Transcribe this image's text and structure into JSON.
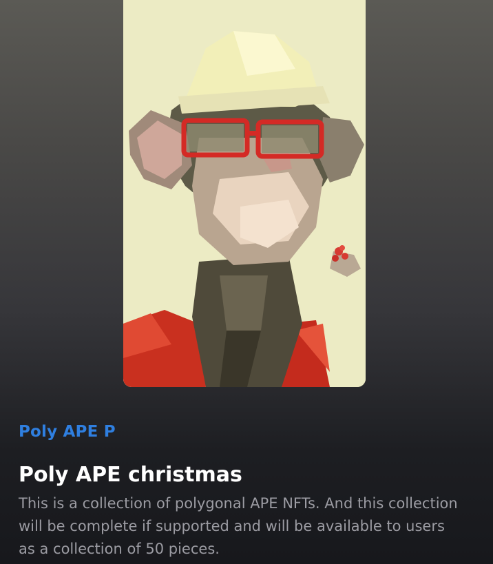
{
  "nft": {
    "image_icon": "polygonal-ape-artwork",
    "collection": "Poly APE P",
    "title": "Poly APE christmas",
    "description": "This is a collection of polygonal APE NFTs. And this collection will be complete if supported and will be available to users as a collection of 50 pieces."
  },
  "colors": {
    "collection_accent": "#2f7fe0",
    "title": "#ffffff",
    "description": "#9c9ca3",
    "background_top": "#5b5a55",
    "background_bottom": "#17181c"
  }
}
